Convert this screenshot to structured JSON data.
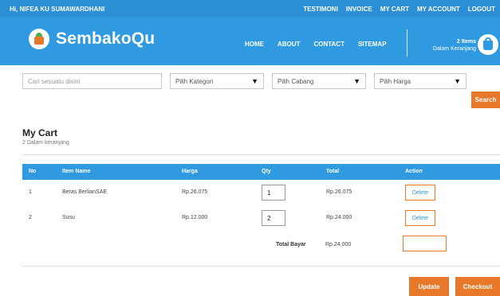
{
  "topbar": {
    "greeting": "Hi, NIFEA KU SUMAWARDHANI",
    "links": [
      "TESTIMONI",
      "INVOICE",
      "MY CART",
      "MY ACCOUNT",
      "LOGOUT"
    ]
  },
  "header": {
    "brand": "SembakoQu",
    "nav": [
      "HOME",
      "ABOUT",
      "CONTACT",
      "SITEMAP"
    ],
    "cart_count": "2 Items",
    "cart_status": "Dalam Keranjang"
  },
  "search": {
    "placeholder": "Cari sesuatu disini",
    "category": "Pilih Kategori",
    "branch": "Pilih Cabang",
    "price": "Pilih Harga",
    "button": "Search"
  },
  "cart": {
    "title": "My Cart",
    "subtitle": "2 Dalam keranjang",
    "columns": [
      "No",
      "Item Name",
      "Harga",
      "Qty",
      "Total",
      "Action"
    ],
    "rows": [
      {
        "no": "1",
        "name": "Beras BerlianSAE",
        "harga": "Rp.26.075",
        "qty": "1",
        "total": "Rp.26.075",
        "action": "Delete"
      },
      {
        "no": "2",
        "name": "Susu",
        "harga": "Rp.12.000",
        "qty": "2",
        "total": "Rp.24.000",
        "action": "Delete"
      }
    ],
    "total_label": "Total Bayar",
    "total_value": "Rp.24.000",
    "update": "Update",
    "checkout": "Checkout"
  },
  "colors": {
    "primary": "#2f9ae0",
    "accent": "#e8792a"
  }
}
